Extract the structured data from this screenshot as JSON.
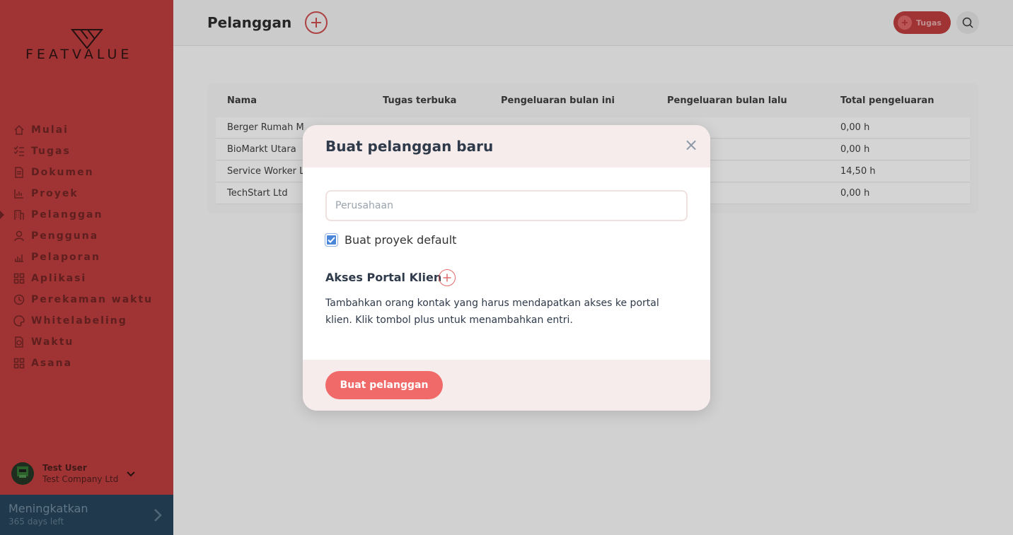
{
  "brand": {
    "logo_text": "FEATVALUE"
  },
  "sidebar": {
    "items": [
      {
        "label": "Mulai",
        "icon": "home-icon"
      },
      {
        "label": "Tugas",
        "icon": "tasks-icon"
      },
      {
        "label": "Dokumen",
        "icon": "documents-icon"
      },
      {
        "label": "Proyek",
        "icon": "projects-icon"
      },
      {
        "label": "Pelanggan",
        "icon": "customers-icon",
        "active": true
      },
      {
        "label": "Pengguna",
        "icon": "user-icon"
      },
      {
        "label": "Pelaporan",
        "icon": "reports-icon"
      },
      {
        "label": "Aplikasi",
        "icon": "apps-icon"
      },
      {
        "label": "Perekaman waktu",
        "icon": "time-tracking-icon"
      },
      {
        "label": "Whitelabeling",
        "icon": "whitelabel-icon"
      },
      {
        "label": "Waktu",
        "icon": "time-icon"
      },
      {
        "label": "Asana",
        "icon": "asana-icon"
      }
    ],
    "user": {
      "name": "Test User",
      "company": "Test Company Ltd"
    },
    "upgrade": {
      "title": "Meningkatkan",
      "subtitle": "365 days left"
    }
  },
  "header": {
    "title": "Pelanggan",
    "task_button_label": "Tugas"
  },
  "table": {
    "columns": [
      "Nama",
      "Tugas terbuka",
      "Pengeluaran bulan ini",
      "Pengeluaran bulan lalu",
      "Total pengeluaran"
    ],
    "rows": [
      {
        "name": "Berger Rumah M",
        "total": "0,00 h"
      },
      {
        "name": "BioMarkt Utara",
        "total": "0,00 h"
      },
      {
        "name": "Service Worker L",
        "total": "14,50 h"
      },
      {
        "name": "TechStart Ltd",
        "total": "0,00 h"
      }
    ]
  },
  "modal": {
    "title": "Buat pelanggan baru",
    "company_placeholder": "Perusahaan",
    "company_value": "",
    "default_project_label": "Buat proyek default",
    "default_project_checked": true,
    "portal_title": "Akses Portal Klien",
    "portal_description": "Tambahkan orang kontak yang harus mendapatkan akses ke portal klien. Klik tombol plus untuk menambahkan entri.",
    "create_button_label": "Buat pelanggan"
  },
  "colors": {
    "sidebar_bg": "#b33a3a",
    "accent": "#f06a6a",
    "upgrade_bg": "#244055",
    "checkbox": "#4a86d8"
  }
}
